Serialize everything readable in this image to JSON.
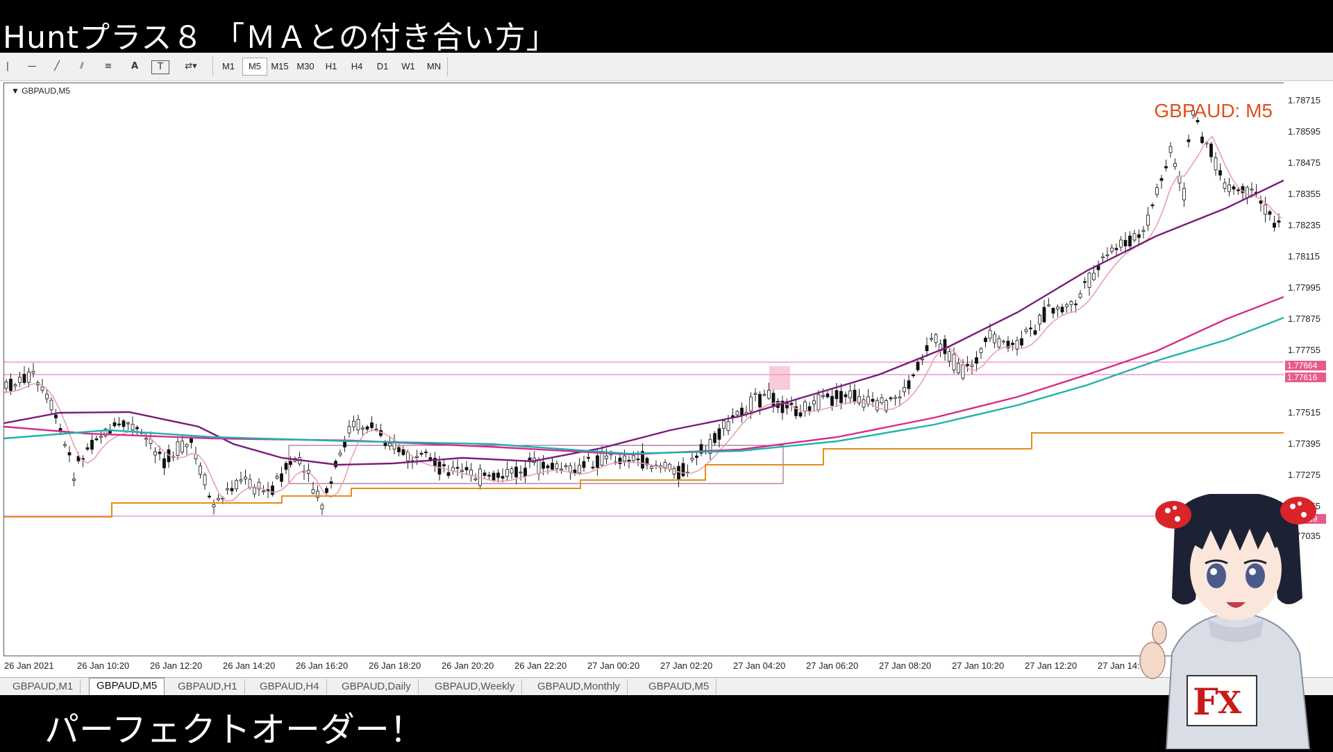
{
  "video_title": "Huntプラス８ 「ＭＡとの付き合い方」",
  "subtitle": "パーフェクトオーダー！",
  "toolbar": {
    "tools": [
      {
        "icon": "cursor-line-icon",
        "glyph": "|"
      },
      {
        "icon": "horizontal-line-icon",
        "glyph": "—"
      },
      {
        "icon": "trendline-icon",
        "glyph": "╱"
      },
      {
        "icon": "channel-icon",
        "glyph": "⫽"
      },
      {
        "icon": "fibonacci-icon",
        "glyph": "≡"
      },
      {
        "icon": "text-icon",
        "glyph": "A"
      },
      {
        "icon": "text-label-icon",
        "glyph": "T"
      },
      {
        "icon": "shapes-dropdown-icon",
        "glyph": "⇄▾"
      }
    ],
    "timeframes": [
      "M1",
      "M5",
      "M15",
      "M30",
      "H1",
      "H4",
      "D1",
      "W1",
      "MN"
    ],
    "active_timeframe": "M5"
  },
  "chart": {
    "symbol_header": "GBPAUD,M5",
    "watermark": "GBPAUD: M5",
    "price_ticks": [
      "1.78715",
      "1.78595",
      "1.78475",
      "1.78355",
      "1.78235",
      "1.78115",
      "1.77995",
      "1.77875",
      "1.77755",
      "1.77515",
      "1.77395",
      "1.77275",
      "1.77155",
      "1.77035"
    ],
    "price_tags": [
      {
        "label": "1.77664",
        "color": "#e75a8c"
      },
      {
        "label": "1.77616",
        "color": "#e75a8c"
      },
      {
        "label": "1.77069",
        "color": "#e75a8c"
      }
    ],
    "time_ticks": [
      "26 Jan 2021",
      "26 Jan 10:20",
      "26 Jan 12:20",
      "26 Jan 14:20",
      "26 Jan 16:20",
      "26 Jan 18:20",
      "26 Jan 20:20",
      "26 Jan 22:20",
      "27 Jan 00:20",
      "27 Jan 02:20",
      "27 Jan 04:20",
      "27 Jan 06:20",
      "27 Jan 08:20",
      "27 Jan 10:20",
      "27 Jan 12:20",
      "27 Jan 14:"
    ],
    "ma_colors": {
      "ma_fast": "#e8a0b0",
      "ma_mid": "#7a1a7a",
      "ma_slow1": "#d62a8a",
      "ma_slow2": "#20b0b0",
      "level_line": "#e88a1a",
      "hline": "#e060c0"
    }
  },
  "tabs": [
    "GBPAUD,M1",
    "GBPAUD,M5",
    "GBPAUD,H1",
    "GBPAUD,H4",
    "GBPAUD,Daily",
    "GBPAUD,Weekly",
    "GBPAUD,Monthly",
    "GBPAUD,M5"
  ],
  "active_tab": 1
}
